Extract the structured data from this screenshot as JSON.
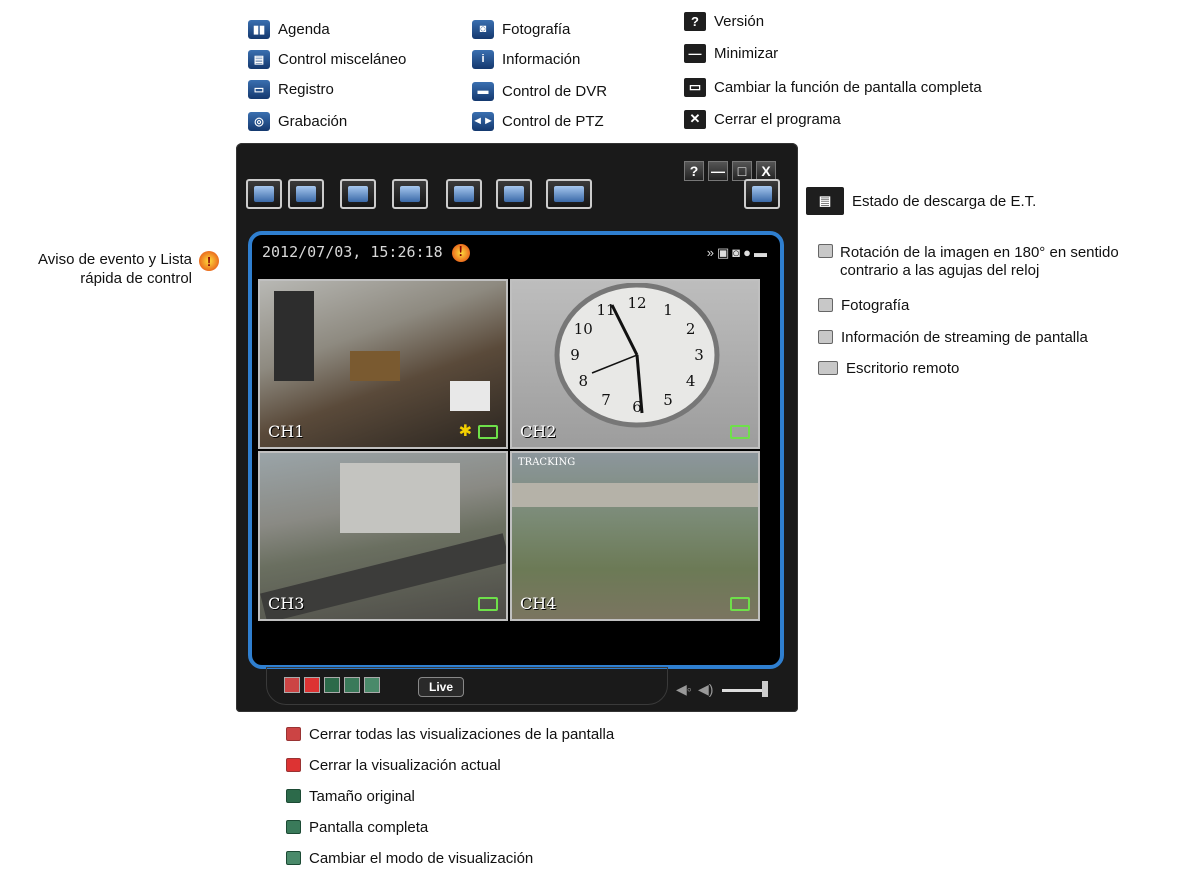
{
  "top_legend": {
    "col1": [
      "Agenda",
      "Control misceláneo",
      "Registro",
      "Grabación"
    ],
    "col2": [
      "Fotografía",
      "Información",
      "Control de DVR",
      "Control de PTZ"
    ],
    "col3": [
      "Versión",
      "Minimizar",
      "Cambiar la función de pantalla completa",
      "Cerrar el programa"
    ]
  },
  "window": {
    "title_buttons": [
      "?",
      "—",
      "□",
      "X"
    ],
    "datetime": "2012/07/03, 15:26:18",
    "channels": [
      "CH1",
      "CH2",
      "CH3",
      "CH4"
    ],
    "tracking_label": "TRACKING",
    "live_label": "Live",
    "clock_numbers": [
      "12",
      "1",
      "2",
      "3",
      "4",
      "5",
      "6",
      "7",
      "8",
      "9",
      "10",
      "11"
    ]
  },
  "right_top_label": "Estado de descarga de E.T.",
  "left_label": {
    "line1": "Aviso de evento y Lista",
    "line2": "rápida de control"
  },
  "right_legend": [
    {
      "line1": "Rotación de la imagen en 180° en sentido",
      "line2": "contrario a las agujas del reloj"
    },
    {
      "line1": "Fotografía"
    },
    {
      "line1": "Información de streaming de pantalla"
    },
    {
      "line1": "Escritorio remoto"
    }
  ],
  "bottom_legend": [
    "Cerrar todas las visualizaciones de la pantalla",
    "Cerrar la visualización actual",
    "Tamaño original",
    "Pantalla completa",
    "Cambiar el modo de visualización"
  ],
  "colors": {
    "frame_blue": "#2f7fd0",
    "alert_red": "#e23c10",
    "cam_green": "#6ee04a"
  }
}
